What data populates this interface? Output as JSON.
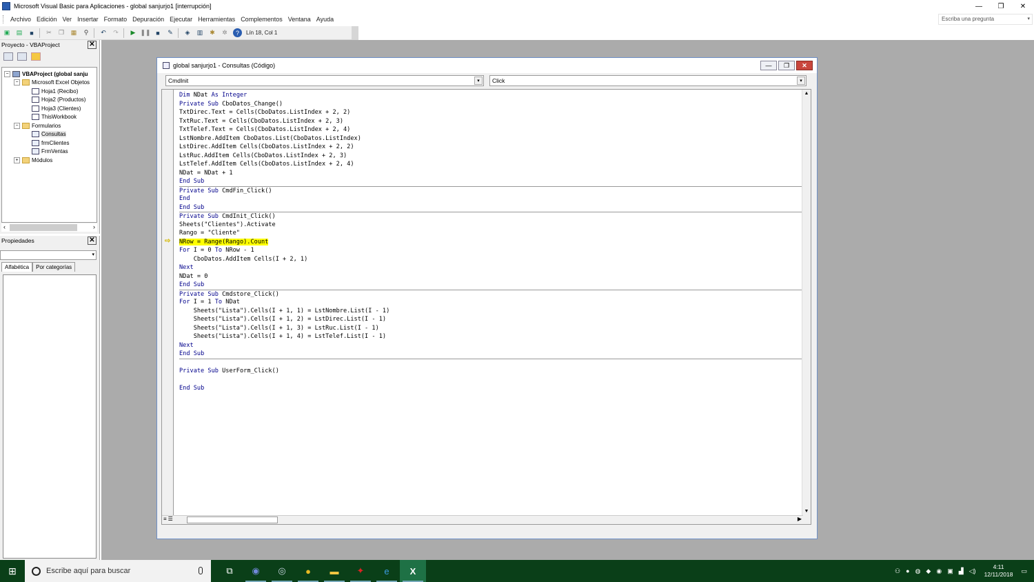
{
  "window": {
    "title": "Microsoft Visual Basic para Aplicaciones - global sanjurjo1 [interrupción]",
    "controls": [
      "—",
      "❐",
      "✕"
    ]
  },
  "menu": {
    "items": [
      "Archivo",
      "Edición",
      "Ver",
      "Insertar",
      "Formato",
      "Depuración",
      "Ejecutar",
      "Herramientas",
      "Complementos",
      "Ventana",
      "Ayuda"
    ],
    "search_placeholder": "Escriba una pregunta"
  },
  "toolbar": {
    "position": "Lín 18, Col 1"
  },
  "project_panel": {
    "title": "Proyecto - VBAProject",
    "close": "✕",
    "tree": [
      {
        "label": "VBAProject (global sanju",
        "level": 0,
        "expander": "−",
        "icon": "proj",
        "bold": true
      },
      {
        "label": "Microsoft Excel Objetos",
        "level": 1,
        "expander": "−",
        "icon": "folder"
      },
      {
        "label": "Hoja1 (Recibo)",
        "level": 2,
        "expander": "",
        "icon": "sheet"
      },
      {
        "label": "Hoja2 (Productos)",
        "level": 2,
        "expander": "",
        "icon": "sheet"
      },
      {
        "label": "Hoja3 (Clientes)",
        "level": 2,
        "expander": "",
        "icon": "sheet"
      },
      {
        "label": "ThisWorkbook",
        "level": 2,
        "expander": "",
        "icon": "sheet"
      },
      {
        "label": "Formularios",
        "level": 1,
        "expander": "−",
        "icon": "folder"
      },
      {
        "label": "Consultas",
        "level": 2,
        "expander": "",
        "icon": "form",
        "selected": true
      },
      {
        "label": "frmClientes",
        "level": 2,
        "expander": "",
        "icon": "form"
      },
      {
        "label": "FrmVentas",
        "level": 2,
        "expander": "",
        "icon": "form"
      },
      {
        "label": "Módulos",
        "level": 1,
        "expander": "+",
        "icon": "folder"
      }
    ]
  },
  "properties_panel": {
    "title": "Propiedades",
    "close": "✕",
    "tabs": [
      "Alfabética",
      "Por categorías"
    ]
  },
  "code_window": {
    "title": "global sanjurjo1 - Consultas (Código)",
    "object_dropdown": "CmdInit",
    "procedure_dropdown": "Click",
    "lines": [
      {
        "text": "Dim NDat As Integer",
        "keyword": true
      },
      {
        "text": "Private Sub CboDatos_Change()",
        "keyword": true
      },
      {
        "text": "TxtDirec.Text = Cells(CboDatos.ListIndex + 2, 2)"
      },
      {
        "text": "TxtRuc.Text = Cells(CboDatos.ListIndex + 2, 3)"
      },
      {
        "text": "TxtTelef.Text = Cells(CboDatos.ListIndex + 2, 4)"
      },
      {
        "text": "LstNombre.AddItem CboDatos.List(CboDatos.ListIndex)"
      },
      {
        "text": "LstDirec.AddItem Cells(CboDatos.ListIndex + 2, 2)"
      },
      {
        "text": "LstRuc.AddItem Cells(CboDatos.ListIndex + 2, 3)"
      },
      {
        "text": "LstTelef.AddItem Cells(CboDatos.ListIndex + 2, 4)"
      },
      {
        "text": "NDat = NDat + 1"
      },
      {
        "text": "End Sub",
        "keyword": true
      },
      {
        "text": "Private Sub CmdFin_Click()",
        "keyword": true,
        "sep": true
      },
      {
        "text": "End",
        "keyword": true
      },
      {
        "text": "End Sub",
        "keyword": true
      },
      {
        "text": "Private Sub CmdInit_Click()",
        "keyword": true,
        "sep": true
      },
      {
        "text": "Sheets(\"Clientes\").Activate"
      },
      {
        "text": "Rango = \"Cliente\""
      },
      {
        "text": "NRow = Range(Rango).Count",
        "highlight": true
      },
      {
        "text": "For I = 0 To NRow - 1",
        "keyword": true
      },
      {
        "text": "    CboDatos.AddItem Cells(I + 2, 1)"
      },
      {
        "text": "Next",
        "keyword": true
      },
      {
        "text": "NDat = 0"
      },
      {
        "text": "End Sub",
        "keyword": true
      },
      {
        "text": "Private Sub Cmdstore_Click()",
        "keyword": true,
        "sep": true
      },
      {
        "text": "For I = 1 To NDat",
        "keyword": true
      },
      {
        "text": "    Sheets(\"Lista\").Cells(I + 1, 1) = LstNombre.List(I - 1)"
      },
      {
        "text": "    Sheets(\"Lista\").Cells(I + 1, 2) = LstDirec.List(I - 1)"
      },
      {
        "text": "    Sheets(\"Lista\").Cells(I + 1, 3) = LstRuc.List(I - 1)"
      },
      {
        "text": "    Sheets(\"Lista\").Cells(I + 1, 4) = LstTelef.List(I - 1)"
      },
      {
        "text": "Next",
        "keyword": true
      },
      {
        "text": "End Sub",
        "keyword": true
      },
      {
        "text": "",
        "sep": true
      },
      {
        "text": "Private Sub UserForm_Click()",
        "keyword": true
      },
      {
        "text": ""
      },
      {
        "text": "End Sub",
        "keyword": true
      }
    ]
  },
  "taskbar": {
    "search_text": "Escribe aquí para buscar",
    "apps": [
      {
        "name": "task-view",
        "glyph": "⧉"
      },
      {
        "name": "discord",
        "glyph": "◉"
      },
      {
        "name": "steam",
        "glyph": "◎"
      },
      {
        "name": "chrome",
        "glyph": "●"
      },
      {
        "name": "file-explorer",
        "glyph": "▬"
      },
      {
        "name": "game-app",
        "glyph": "✦"
      },
      {
        "name": "edge",
        "glyph": "e"
      },
      {
        "name": "excel",
        "glyph": "X"
      }
    ],
    "clock_time": "4:11",
    "clock_date": "12/11/2018"
  }
}
